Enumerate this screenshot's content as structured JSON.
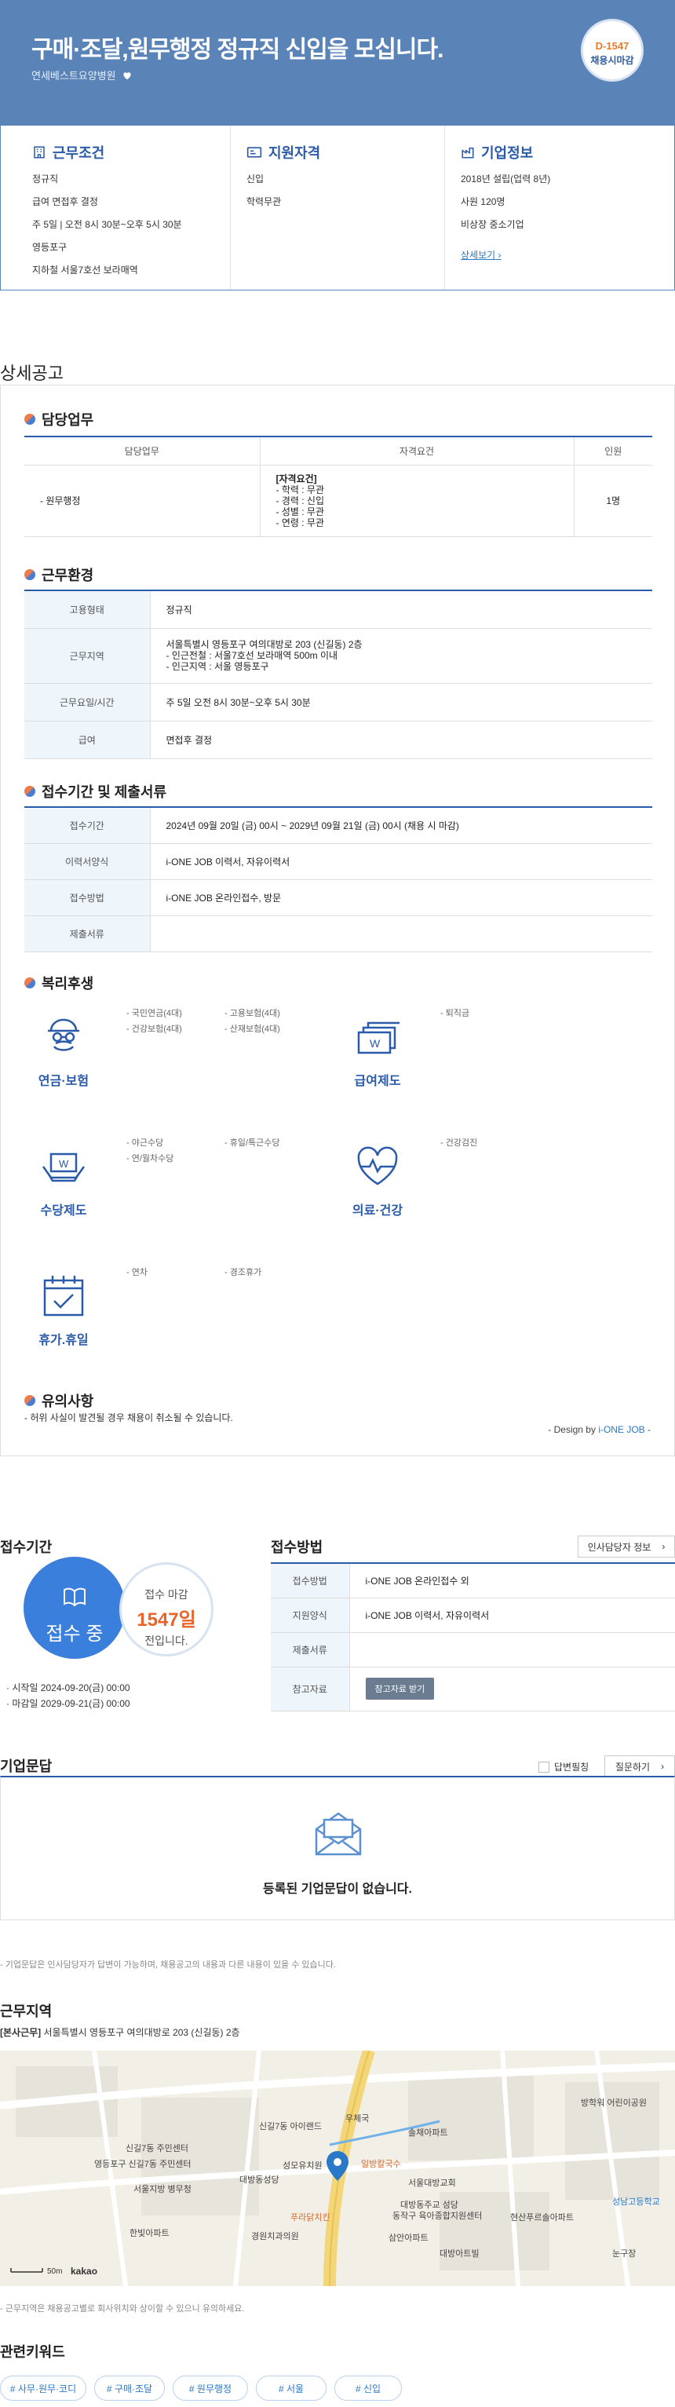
{
  "hero": {
    "title": "구매·조달,원무행정 정규직 신입을 모십니다.",
    "company": "연세베스트요양병원",
    "dday": "D-1547",
    "dday_label": "채용시마감"
  },
  "summary": {
    "work": {
      "title": "근무조건",
      "items": [
        "정규직",
        "급여 면접후 결정",
        "주 5일 | 오전 8시 30분~오후 5시 30분",
        "영등포구",
        "지하철 서울7호선 보라매역"
      ]
    },
    "qual": {
      "title": "지원자격",
      "items": [
        "신입",
        "학력무관"
      ]
    },
    "company": {
      "title": "기업정보",
      "items": [
        "2018년 설립(업력 8년)",
        "사원 120명",
        "비상장 중소기업"
      ],
      "link": "상세보기"
    }
  },
  "detail_title": "상세공고",
  "duty": {
    "title": "담당업무",
    "headers": [
      "담당업무",
      "자격요건",
      "인원"
    ],
    "row": {
      "task": "- 원무행정",
      "req_title": "[자격요건]",
      "req_lines": "- 학력 : 무관\n- 경력 : 신입\n- 성별 : 무관\n- 연령 : 무관",
      "count": "1명"
    }
  },
  "env": {
    "title": "근무환경",
    "rows": [
      {
        "k": "고용형태",
        "v": "정규직"
      },
      {
        "k": "근무지역",
        "v": "서울특별시 영등포구 여의대방로 203 (신길동) 2층\n- 인근전철 : 서울7호선 보라매역 500m 이내\n- 인근지역 : 서울 영등포구"
      },
      {
        "k": "근무요일/시간",
        "v": "주 5일 오전 8시 30분~오후 5시 30분"
      },
      {
        "k": "급여",
        "v": "면접후 결정"
      }
    ]
  },
  "apply": {
    "title": "접수기간 및 제출서류",
    "rows": [
      {
        "k": "접수기간",
        "v": "2024년 09월 20일 (금) 00시 ~ 2029년 09월 21일 (금) 00시 (채용 시 마감)"
      },
      {
        "k": "이력서양식",
        "v": "i-ONE JOB 이력서, 자유이력서"
      },
      {
        "k": "접수방법",
        "v": "i-ONE JOB 온라인접수, 방문"
      },
      {
        "k": "제출서류",
        "v": ""
      }
    ]
  },
  "welfare": {
    "title": "복리후생",
    "groups": [
      {
        "label": "연금·보험",
        "items": [
          "- 국민연금(4대)",
          "- 고용보험(4대)",
          "- 건강보험(4대)",
          "- 산재보험(4대)"
        ]
      },
      {
        "label": "급여제도",
        "items": [
          "- 퇴직금"
        ]
      },
      {
        "label": "수당제도",
        "items": [
          "- 야근수당",
          "- 휴일/특근수당",
          "- 연/월차수당"
        ]
      },
      {
        "label": "의료·건강",
        "items": [
          "- 건강검진"
        ]
      },
      {
        "label": "휴가.휴일",
        "items": [
          "- 연차",
          "- 경조휴가"
        ]
      }
    ]
  },
  "caution": {
    "title": "유의사항",
    "text": "- 허위 사실이 발견될 경우 채용이 취소될 수 있습니다.",
    "design_prefix": "- Design by ",
    "design_link": "i-ONE JOB",
    "design_suffix": " -"
  },
  "period": {
    "title": "접수기간",
    "status": "접수 중",
    "deadline_label": "접수 마감",
    "days": "1547일",
    "days_suffix": "전입니다.",
    "start": "시작일 2024-09-20(금) 00:00",
    "end": "마감일 2029-09-21(금) 00:00"
  },
  "method": {
    "title": "접수방법",
    "hr_button": "인사담당자 정보",
    "rows": [
      {
        "k": "접수방법",
        "v": "i-ONE JOB 온라인접수 외"
      },
      {
        "k": "지원양식",
        "v": "i-ONE JOB 이력서, 자유이력서"
      },
      {
        "k": "제출서류",
        "v": ""
      },
      {
        "k": "참고자료",
        "v": ""
      }
    ],
    "ref_button": "참고자료 받기"
  },
  "qa": {
    "title": "기업문답",
    "check_label": "답변필칭",
    "ask_button": "질문하기",
    "empty": "등록된 기업문답이 없습니다.",
    "note": "- 기업문답은 인사담당자가 답변이 가능하며, 채용공고의 내용과 다른 내용이 있을 수 있습니다."
  },
  "location": {
    "title": "근무지역",
    "tag": "[본사근무]",
    "address": "서울특별시 영등포구 여의대방로 203 (신길동) 2층",
    "note": "- 근무지역은 채용공고별로 회사위치와 상이할 수 있으니 유의하세요.",
    "map": {
      "scale": "50m",
      "brand": "kakao",
      "labels": [
        "신길7동 아이랜드",
        "영등포구 신길7동 주민센터",
        "성모유치원",
        "일방칼국수",
        "서울대방교회",
        "솔채아파트",
        "삼안아파트",
        "대방아트빌",
        "신길7동 주민센터",
        "방학워 어린이공원",
        "성남고등학교",
        "대방동주교 성당",
        "동작구 육아종합지원센터",
        "푸라닭치킨",
        "경원치과의원",
        "현산푸르솔아파트",
        "눈구장",
        "한빛아파트",
        "대방동성당",
        "우체국",
        "서울지방 병무청"
      ]
    }
  },
  "keywords": {
    "title": "관련키워드",
    "items": [
      "# 사무·원무·코디",
      "# 구매·조달",
      "# 원무행정",
      "# 서울",
      "# 신입"
    ]
  }
}
